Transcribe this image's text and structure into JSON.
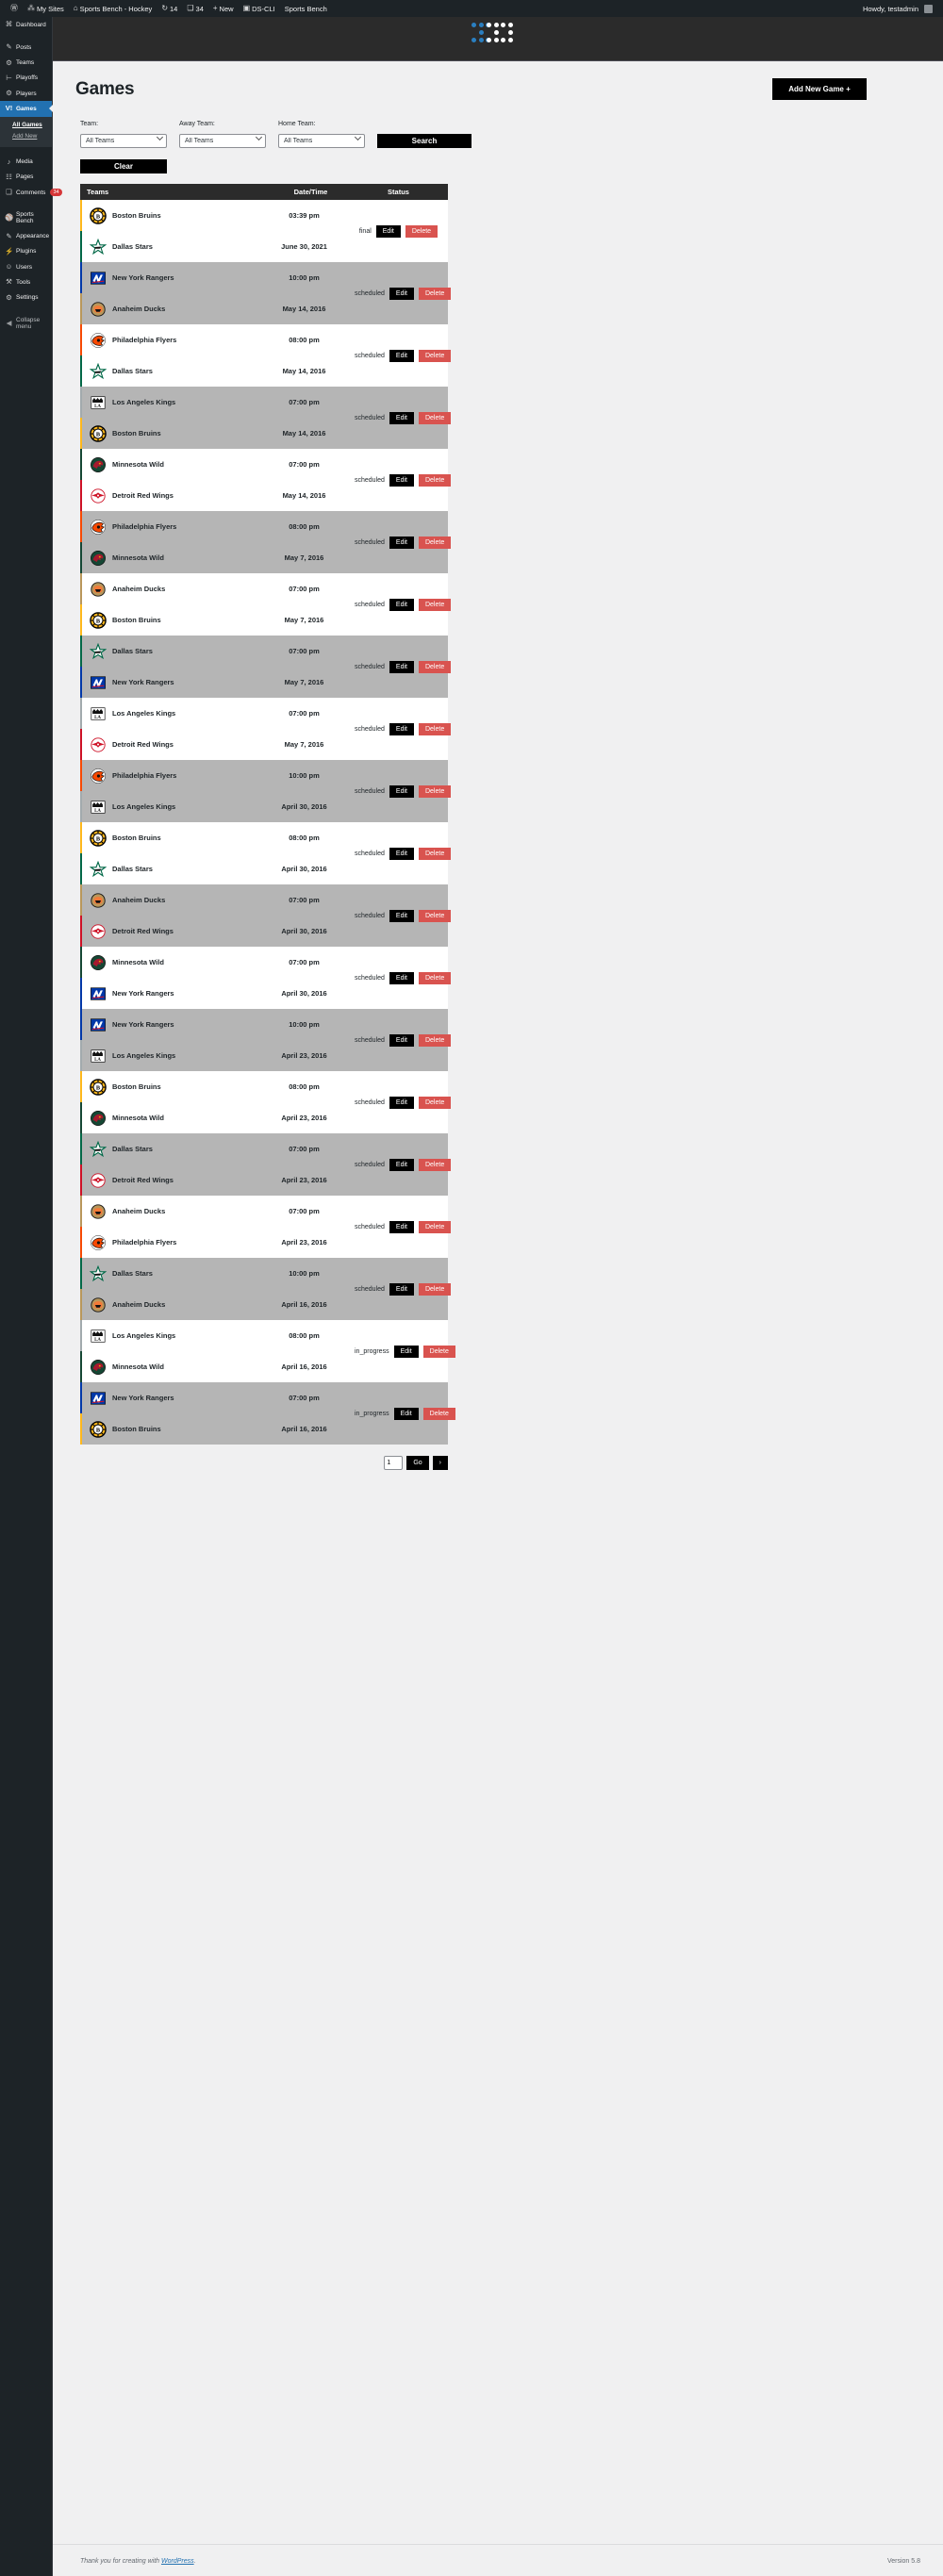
{
  "adminbar": {
    "items": [
      {
        "icon": "wordpress-icon",
        "glyph": "Ⓦ",
        "label": ""
      },
      {
        "icon": "my-sites-icon",
        "glyph": "⁂",
        "label": "My Sites"
      },
      {
        "icon": "site-icon",
        "glyph": "⌂",
        "label": "Sports Bench - Hockey"
      },
      {
        "icon": "updates-icon",
        "glyph": "↻",
        "label": "14"
      },
      {
        "icon": "comments-icon",
        "glyph": "❑",
        "label": "34"
      },
      {
        "icon": "new-content-icon",
        "glyph": "+",
        "label": "New"
      },
      {
        "icon": "ds-cli-icon",
        "glyph": "▣",
        "label": "DS-CLI"
      },
      {
        "icon": "sports-bench-icon",
        "glyph": "",
        "label": "Sports Bench"
      }
    ],
    "howdy": "Howdy, testadmin"
  },
  "sidebar": {
    "items": [
      {
        "label": "Dashboard",
        "icon": "dashboard-icon",
        "glyph": "⌘",
        "current": false
      },
      {
        "label": "Posts",
        "icon": "posts-icon",
        "glyph": "✎",
        "current": false,
        "sep_before": true
      },
      {
        "label": "Teams",
        "icon": "teams-icon",
        "glyph": "⚙",
        "current": false
      },
      {
        "label": "Playoffs",
        "icon": "playoffs-icon",
        "glyph": "⊢",
        "current": false
      },
      {
        "label": "Players",
        "icon": "players-icon",
        "glyph": "⚙",
        "current": false
      },
      {
        "label": "Games",
        "icon": "games-icon",
        "glyph": "V!",
        "current": true
      }
    ],
    "games_submenu": [
      {
        "label": "All Games",
        "current": true
      },
      {
        "label": "Add New",
        "current": false
      }
    ],
    "items_after": [
      {
        "label": "Media",
        "icon": "media-icon",
        "glyph": "♪",
        "current": false,
        "sep_before": true
      },
      {
        "label": "Pages",
        "icon": "pages-icon",
        "glyph": "☷",
        "current": false
      },
      {
        "label": "Comments",
        "icon": "comments-icon",
        "glyph": "❑",
        "current": false,
        "badge": "34"
      },
      {
        "label": "Sports Bench",
        "icon": "sports-bench-icon",
        "glyph": "⚾",
        "current": false,
        "sep_before": true
      },
      {
        "label": "Appearance",
        "icon": "appearance-icon",
        "glyph": "✎",
        "current": false
      },
      {
        "label": "Plugins",
        "icon": "plugins-icon",
        "glyph": "⚡",
        "current": false
      },
      {
        "label": "Users",
        "icon": "users-icon",
        "glyph": "☺",
        "current": false
      },
      {
        "label": "Tools",
        "icon": "tools-icon",
        "glyph": "⚒",
        "current": false
      },
      {
        "label": "Settings",
        "icon": "settings-icon",
        "glyph": "⚙",
        "current": false
      }
    ],
    "collapse": {
      "label": "Collapse menu",
      "icon": "collapse-icon",
      "glyph": "◀"
    }
  },
  "header": {
    "logo_name": "sports-bench-logo",
    "page_title": "Games",
    "add_new_game_label": "Add New Game +"
  },
  "filters": {
    "team": {
      "label": "Team:",
      "value": "All Teams"
    },
    "away_team": {
      "label": "Away Team:",
      "value": "All Teams"
    },
    "home_team": {
      "label": "Home Team:",
      "value": "All Teams"
    },
    "search_label": "Search",
    "clear_label": "Clear"
  },
  "table": {
    "columns": {
      "teams": "Teams",
      "date": "Date/Time",
      "status": "Status"
    },
    "edit_label": "Edit",
    "delete_label": "Delete",
    "rows": [
      {
        "away": {
          "name": "Boston Bruins",
          "logo": "bruins-logo",
          "color": "#FFB81C"
        },
        "home": {
          "name": "Dallas Stars",
          "logo": "stars-logo",
          "color": "#006847"
        },
        "time": "03:39 pm",
        "date": "June 30, 2021",
        "status": "final"
      },
      {
        "away": {
          "name": "New York Rangers",
          "logo": "rangers-logo",
          "color": "#0038A8"
        },
        "home": {
          "name": "Anaheim Ducks",
          "logo": "ducks-logo",
          "color": "#B9975B"
        },
        "time": "10:00 pm",
        "date": "May 14, 2016",
        "status": "scheduled"
      },
      {
        "away": {
          "name": "Philadelphia Flyers",
          "logo": "flyers-logo",
          "color": "#F74902"
        },
        "home": {
          "name": "Dallas Stars",
          "logo": "stars-logo",
          "color": "#006847"
        },
        "time": "08:00 pm",
        "date": "May 14, 2016",
        "status": "scheduled"
      },
      {
        "away": {
          "name": "Los Angeles Kings",
          "logo": "kings-logo",
          "color": "#A2AAAD"
        },
        "home": {
          "name": "Boston Bruins",
          "logo": "bruins-logo",
          "color": "#FFB81C"
        },
        "time": "07:00 pm",
        "date": "May 14, 2016",
        "status": "scheduled"
      },
      {
        "away": {
          "name": "Minnesota Wild",
          "logo": "wild-logo",
          "color": "#154734"
        },
        "home": {
          "name": "Detroit Red Wings",
          "logo": "redwings-logo",
          "color": "#CE1126"
        },
        "time": "07:00 pm",
        "date": "May 14, 2016",
        "status": "scheduled"
      },
      {
        "away": {
          "name": "Philadelphia Flyers",
          "logo": "flyers-logo",
          "color": "#F74902"
        },
        "home": {
          "name": "Minnesota Wild",
          "logo": "wild-logo",
          "color": "#154734"
        },
        "time": "08:00 pm",
        "date": "May 7, 2016",
        "status": "scheduled"
      },
      {
        "away": {
          "name": "Anaheim Ducks",
          "logo": "ducks-logo",
          "color": "#B9975B"
        },
        "home": {
          "name": "Boston Bruins",
          "logo": "bruins-logo",
          "color": "#FFB81C"
        },
        "time": "07:00 pm",
        "date": "May 7, 2016",
        "status": "scheduled"
      },
      {
        "away": {
          "name": "Dallas Stars",
          "logo": "stars-logo",
          "color": "#006847"
        },
        "home": {
          "name": "New York Rangers",
          "logo": "rangers-logo",
          "color": "#0038A8"
        },
        "time": "07:00 pm",
        "date": "May 7, 2016",
        "status": "scheduled"
      },
      {
        "away": {
          "name": "Los Angeles Kings",
          "logo": "kings-logo",
          "color": "#A2AAAD"
        },
        "home": {
          "name": "Detroit Red Wings",
          "logo": "redwings-logo",
          "color": "#CE1126"
        },
        "time": "07:00 pm",
        "date": "May 7, 2016",
        "status": "scheduled"
      },
      {
        "away": {
          "name": "Philadelphia Flyers",
          "logo": "flyers-logo",
          "color": "#F74902"
        },
        "home": {
          "name": "Los Angeles Kings",
          "logo": "kings-logo",
          "color": "#A2AAAD"
        },
        "time": "10:00 pm",
        "date": "April 30, 2016",
        "status": "scheduled"
      },
      {
        "away": {
          "name": "Boston Bruins",
          "logo": "bruins-logo",
          "color": "#FFB81C"
        },
        "home": {
          "name": "Dallas Stars",
          "logo": "stars-logo",
          "color": "#006847"
        },
        "time": "08:00 pm",
        "date": "April 30, 2016",
        "status": "scheduled"
      },
      {
        "away": {
          "name": "Anaheim Ducks",
          "logo": "ducks-logo",
          "color": "#B9975B"
        },
        "home": {
          "name": "Detroit Red Wings",
          "logo": "redwings-logo",
          "color": "#CE1126"
        },
        "time": "07:00 pm",
        "date": "April 30, 2016",
        "status": "scheduled"
      },
      {
        "away": {
          "name": "Minnesota Wild",
          "logo": "wild-logo",
          "color": "#154734"
        },
        "home": {
          "name": "New York Rangers",
          "logo": "rangers-logo",
          "color": "#0038A8"
        },
        "time": "07:00 pm",
        "date": "April 30, 2016",
        "status": "scheduled"
      },
      {
        "away": {
          "name": "New York Rangers",
          "logo": "rangers-logo",
          "color": "#0038A8"
        },
        "home": {
          "name": "Los Angeles Kings",
          "logo": "kings-logo",
          "color": "#A2AAAD"
        },
        "time": "10:00 pm",
        "date": "April 23, 2016",
        "status": "scheduled"
      },
      {
        "away": {
          "name": "Boston Bruins",
          "logo": "bruins-logo",
          "color": "#FFB81C"
        },
        "home": {
          "name": "Minnesota Wild",
          "logo": "wild-logo",
          "color": "#154734"
        },
        "time": "08:00 pm",
        "date": "April 23, 2016",
        "status": "scheduled"
      },
      {
        "away": {
          "name": "Dallas Stars",
          "logo": "stars-logo",
          "color": "#006847"
        },
        "home": {
          "name": "Detroit Red Wings",
          "logo": "redwings-logo",
          "color": "#CE1126"
        },
        "time": "07:00 pm",
        "date": "April 23, 2016",
        "status": "scheduled"
      },
      {
        "away": {
          "name": "Anaheim Ducks",
          "logo": "ducks-logo",
          "color": "#B9975B"
        },
        "home": {
          "name": "Philadelphia Flyers",
          "logo": "flyers-logo",
          "color": "#F74902"
        },
        "time": "07:00 pm",
        "date": "April 23, 2016",
        "status": "scheduled"
      },
      {
        "away": {
          "name": "Dallas Stars",
          "logo": "stars-logo",
          "color": "#006847"
        },
        "home": {
          "name": "Anaheim Ducks",
          "logo": "ducks-logo",
          "color": "#B9975B"
        },
        "time": "10:00 pm",
        "date": "April 16, 2016",
        "status": "scheduled"
      },
      {
        "away": {
          "name": "Los Angeles Kings",
          "logo": "kings-logo",
          "color": "#A2AAAD"
        },
        "home": {
          "name": "Minnesota Wild",
          "logo": "wild-logo",
          "color": "#154734"
        },
        "time": "08:00 pm",
        "date": "April 16, 2016",
        "status": "in_progress"
      },
      {
        "away": {
          "name": "New York Rangers",
          "logo": "rangers-logo",
          "color": "#0038A8"
        },
        "home": {
          "name": "Boston Bruins",
          "logo": "bruins-logo",
          "color": "#FFB81C"
        },
        "time": "07:00 pm",
        "date": "April 16, 2016",
        "status": "in_progress"
      }
    ]
  },
  "pagination": {
    "current_page": "1",
    "go_label": "Go",
    "next_label": "›"
  },
  "footer": {
    "thanks_prefix": "Thank you for creating with ",
    "wordpress_link": "WordPress",
    "thanks_suffix": ".",
    "version": "Version 5.8"
  }
}
